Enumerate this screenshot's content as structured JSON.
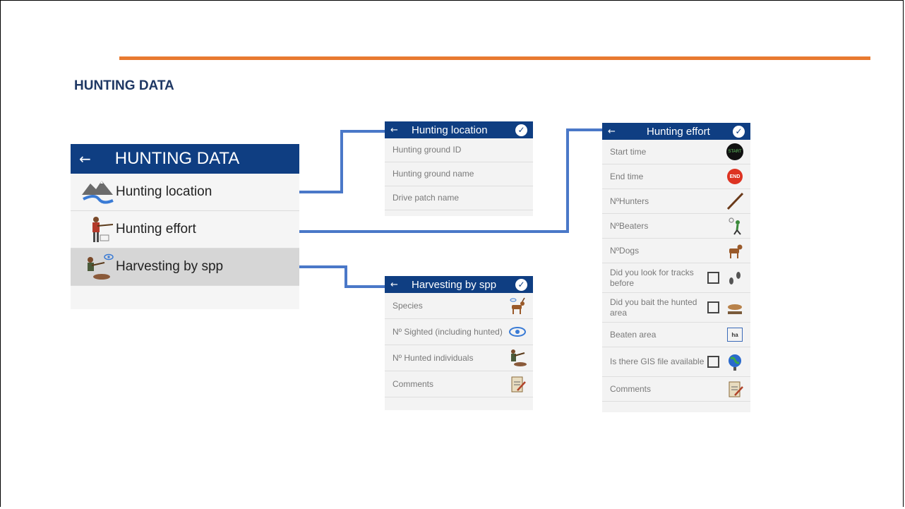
{
  "slide": {
    "title": "HUNTING DATA",
    "accent_color": "#e87a30"
  },
  "colors": {
    "app_bar": "#0f3e82",
    "connector": "#4a78c8"
  },
  "main_screen": {
    "title": "HUNTING DATA",
    "back_icon": "arrow-left-icon",
    "items": [
      {
        "label": "Hunting location",
        "icon": "landscape-icon"
      },
      {
        "label": "Hunting effort",
        "icon": "hunter-icon"
      },
      {
        "label": "Harvesting by spp",
        "icon": "harvest-icon",
        "selected": true
      }
    ]
  },
  "location_form": {
    "title": "Hunting location",
    "fields": [
      "Hunting ground ID",
      "Hunting ground name",
      "Drive patch name"
    ]
  },
  "effort_form": {
    "title": "Hunting effort",
    "fields": [
      {
        "label": "Start time",
        "icon": "start-badge-icon",
        "icon_text": "START"
      },
      {
        "label": "End time",
        "icon": "end-badge-icon",
        "icon_text": "END"
      },
      {
        "label": "NºHunters",
        "icon": "rifle-icon"
      },
      {
        "label": "NºBeaters",
        "icon": "beater-icon"
      },
      {
        "label": "NºDogs",
        "icon": "dog-icon"
      },
      {
        "label": "Did you look for tracks before",
        "icon": "tracks-icon",
        "checkbox": true
      },
      {
        "label": "Did you bait the hunted area",
        "icon": "bait-icon",
        "checkbox": true
      },
      {
        "label": "Beaten area",
        "icon": "hectare-icon",
        "icon_text": "ha"
      },
      {
        "label": "Is there GIS file available",
        "icon": "globe-icon",
        "checkbox": true
      },
      {
        "label": "Comments",
        "icon": "clipboard-icon"
      }
    ]
  },
  "harvest_form": {
    "title": "Harvesting by spp",
    "fields": [
      {
        "label": "Species",
        "icon": "deer-icon"
      },
      {
        "label": "Nº Sighted (including hunted)",
        "icon": "eye-icon"
      },
      {
        "label": "Nº Hunted individuals",
        "icon": "hunter-kneel-icon"
      },
      {
        "label": "Comments",
        "icon": "clipboard-icon"
      }
    ]
  }
}
